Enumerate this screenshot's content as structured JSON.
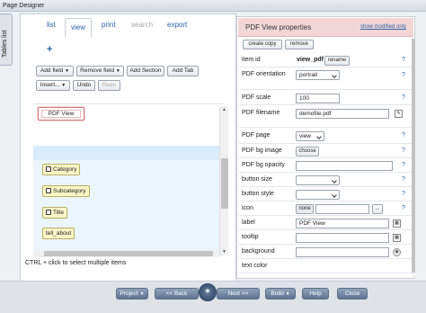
{
  "window": {
    "title": "Page Designer"
  },
  "side_tab": {
    "label": "Tables list"
  },
  "tabs": [
    {
      "label": "list"
    },
    {
      "label": "view"
    },
    {
      "label": "print"
    },
    {
      "label": "search"
    },
    {
      "label": "export"
    }
  ],
  "add_symbol": "+",
  "toolbar": {
    "add_field": "Add field",
    "remove_field": "Remove field",
    "add_section": "Add Section",
    "add_tab": "Add Tab",
    "insert": "Insert...",
    "undo": "Undo",
    "redo": "Redo"
  },
  "canvas": {
    "pdf_view_button": "PDF View",
    "fields": [
      "Category",
      "Subcategory",
      "Title",
      "tell_about"
    ]
  },
  "hint": "CTRL + click to select multiple items",
  "properties": {
    "title": "PDF View properties",
    "show_modified": "show modified only",
    "create_copy": "create copy",
    "remove": "remove",
    "item_id_label": "item id",
    "item_id_value": "view_pdf",
    "rename": "rename",
    "pdf_orientation_label": "PDF orientation",
    "pdf_orientation_value": "portrait",
    "pdf_scale_label": "PDF scale",
    "pdf_scale_value": "100",
    "pdf_filename_label": "PDF filename",
    "pdf_filename_value": "demofile.pdf",
    "pdf_page_label": "PDF page",
    "pdf_page_value": "view",
    "pdf_bg_image_label": "PDF bg image",
    "choose": "choose",
    "pdf_bg_opacity_label": "PDF bg opacity",
    "button_size_label": "button size",
    "button_style_label": "button style",
    "icon_label": "icon",
    "icon_value": "none",
    "icon_more": "...",
    "label_label": "label",
    "label_value": "PDF View",
    "tooltip_label": "tooltip",
    "background_label": "background",
    "text_color_label": "text color",
    "help_mark": "?"
  },
  "bottom_nav": {
    "project": "Project",
    "back": "<< Back",
    "next": "Next >>",
    "build": "Build",
    "help": "Help",
    "close": "Close"
  },
  "colors": {
    "header_bg": "#f2d6d6",
    "nav_button": "#6f84a2",
    "link": "#2a63a6",
    "field_bg": "#fbf6c8",
    "canvas_band": "#d8ecfb"
  }
}
